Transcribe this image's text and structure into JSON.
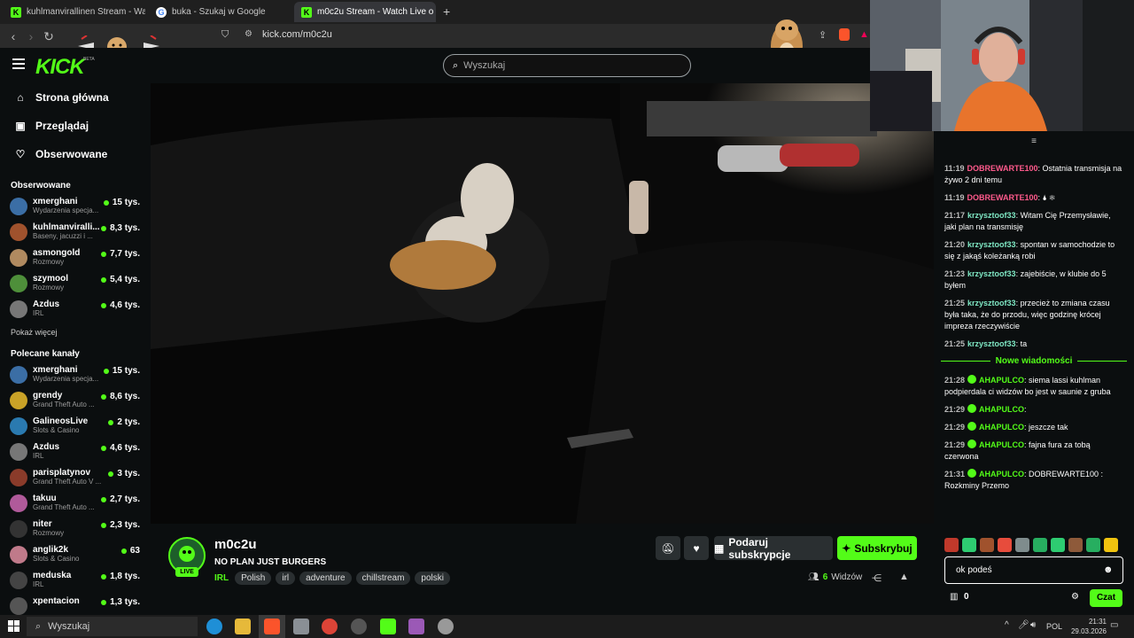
{
  "browser": {
    "tabs": [
      {
        "title": "kuhlmanvirallinen Stream - Watch Liv",
        "icon": "kick-favicon"
      },
      {
        "title": "buka - Szukaj w Google",
        "icon": "google-favicon"
      },
      {
        "title": "m0c2u Stream - Watch Live o",
        "icon": "kick-favicon"
      }
    ],
    "url": "kick.com/m0c2u"
  },
  "header": {
    "logo": "KICK",
    "logo_badge": "BETA",
    "search_placeholder": "Wyszukaj"
  },
  "sidebar": {
    "nav": [
      {
        "label": "Strona główna",
        "icon": "home-icon"
      },
      {
        "label": "Przeglądaj",
        "icon": "browse-icon"
      },
      {
        "label": "Obserwowane",
        "icon": "heart-icon"
      }
    ],
    "followed_title": "Obserwowane",
    "followed": [
      {
        "name": "xmerghani",
        "category": "Wydarzenia specja...",
        "viewers": "15 tys.",
        "color": "#3b6ea5"
      },
      {
        "name": "kuhlmanviralli...",
        "category": "Baseny, jacuzzi i ...",
        "viewers": "8,3 tys.",
        "color": "#a0522d"
      },
      {
        "name": "asmongold",
        "category": "Rozmowy",
        "viewers": "7,7 tys.",
        "color": "#b08a60"
      },
      {
        "name": "szymool",
        "category": "Rozmowy",
        "viewers": "5,4 tys.",
        "color": "#4e8f3a"
      },
      {
        "name": "Azdus",
        "category": "IRL",
        "viewers": "4,6 tys.",
        "color": "#777777"
      }
    ],
    "show_more": "Pokaż więcej",
    "recommended_title": "Polecane kanały",
    "recommended": [
      {
        "name": "xmerghani",
        "category": "Wydarzenia specja...",
        "viewers": "15 tys.",
        "color": "#3b6ea5"
      },
      {
        "name": "grendy",
        "category": "Grand Theft Auto ...",
        "viewers": "8,6 tys.",
        "color": "#c9a227"
      },
      {
        "name": "GalineosLive",
        "category": "Slots & Casino",
        "viewers": "2 tys.",
        "color": "#2a7ab0"
      },
      {
        "name": "Azdus",
        "category": "IRL",
        "viewers": "4,6 tys.",
        "color": "#777777"
      },
      {
        "name": "parisplatynov",
        "category": "Grand Theft Auto V ...",
        "viewers": "3 tys.",
        "color": "#8a3b2a"
      },
      {
        "name": "takuu",
        "category": "Grand Theft Auto ...",
        "viewers": "2,7 tys.",
        "color": "#b05a9a"
      },
      {
        "name": "niter",
        "category": "Rozmowy",
        "viewers": "2,3 tys.",
        "color": "#333333"
      },
      {
        "name": "anglik2k",
        "category": "Slots & Casino",
        "viewers": "63",
        "color": "#c07a8a"
      },
      {
        "name": "meduska",
        "category": "IRL",
        "viewers": "1,8 tys.",
        "color": "#444444"
      },
      {
        "name": "xpentacion",
        "category": "",
        "viewers": "1,3 tys.",
        "color": "#555555"
      }
    ]
  },
  "stream": {
    "name": "m0c2u",
    "title": "NO PLAN JUST BURGERS",
    "live": "LIVE",
    "category": "IRL",
    "tags": [
      "Polish",
      "irl",
      "adventure",
      "chillstream",
      "polski"
    ],
    "gift_label": "Podaruj subskrypcje",
    "subscribe_label": "Subskrybuj",
    "viewers": "6",
    "viewers_label": "Widzów"
  },
  "chat": {
    "messages": [
      {
        "time": "11:19",
        "user": "DOBREWARTE100",
        "color": "#ff5a8c",
        "badge": false,
        "text": ": Ostatnia transmisja na żywo 2 dni temu"
      },
      {
        "time": "11:19",
        "user": "DOBREWARTE100",
        "color": "#ff5a8c",
        "badge": false,
        "text": ": 🌢 ❄"
      },
      {
        "time": "21:17",
        "user": "krzysztoof33",
        "color": "#7fe8c4",
        "badge": false,
        "text": ": Witam Cię Przemysławie, jaki plan na transmisję"
      },
      {
        "time": "21:20",
        "user": "krzysztoof33",
        "color": "#7fe8c4",
        "badge": false,
        "text": ": spontan w samochodzie to się z jakąś koleżanką robi"
      },
      {
        "time": "21:23",
        "user": "krzysztoof33",
        "color": "#7fe8c4",
        "badge": false,
        "text": ": zajebiście, w klubie do 5 byłem"
      },
      {
        "time": "21:25",
        "user": "krzysztoof33",
        "color": "#7fe8c4",
        "badge": false,
        "text": ": przecież to zmiana czasu była taka, że do przodu, więc godzinę krócej impreza rzeczywiście"
      },
      {
        "time": "21:25",
        "user": "krzysztoof33",
        "color": "#7fe8c4",
        "badge": false,
        "text": ": ta"
      }
    ],
    "new_messages_label": "Nowe wiadomości",
    "new_messages": [
      {
        "time": "21:28",
        "user": "AHAPULCO",
        "color": "#53fc18",
        "badge": true,
        "text": ": siema lassi kuhlman podpierdala ci widzów bo jest w saunie z gruba"
      },
      {
        "time": "21:29",
        "user": "AHAPULCO",
        "color": "#53fc18",
        "badge": true,
        "text": ":"
      },
      {
        "time": "21:29",
        "user": "AHAPULCO",
        "color": "#53fc18",
        "badge": true,
        "text": ": jeszcze tak"
      },
      {
        "time": "21:29",
        "user": "AHAPULCO",
        "color": "#53fc18",
        "badge": true,
        "text": ": fajna fura za tobą czerwona"
      },
      {
        "time": "21:31",
        "user": "AHAPULCO",
        "color": "#53fc18",
        "badge": true,
        "text": ": DOBREWARTE100 : Rozkminy Przemo"
      }
    ],
    "input_value": "ok podeś",
    "points": "0",
    "send_label": "Czat"
  },
  "taskbar": {
    "search_placeholder": "Wyszukaj",
    "lang": "POL",
    "time": "21:31",
    "date": "29.03.2026"
  },
  "colors": {
    "accent": "#53fc18",
    "background": "#0b0e0f"
  }
}
